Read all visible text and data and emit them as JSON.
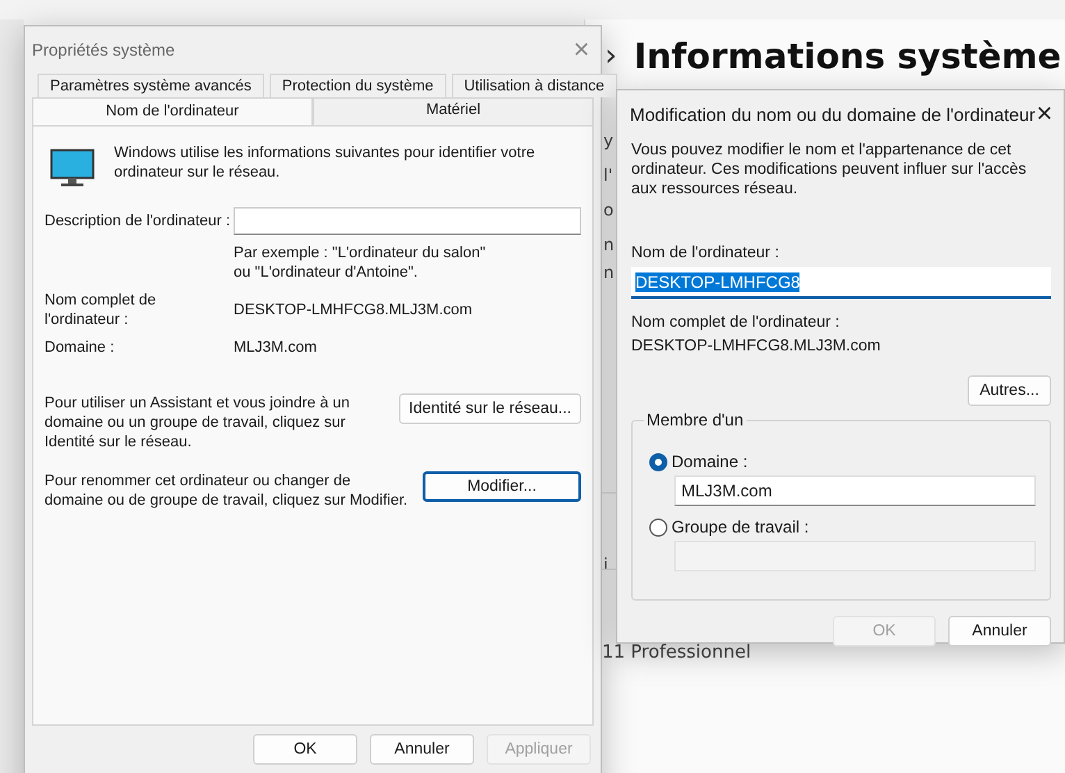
{
  "background_window": {
    "chevron": "›",
    "title": "Informations système",
    "fragments": [
      "y",
      "l'",
      "o",
      "n",
      "n",
      "i"
    ],
    "edition": "11 Professionnel"
  },
  "system_properties": {
    "title": "Propriétés système",
    "close": "×",
    "tab_rows": [
      [
        {
          "label": "Paramètres système avancés",
          "selected": false
        },
        {
          "label": "Protection du système",
          "selected": false
        },
        {
          "label": "Utilisation à distance",
          "selected": false
        }
      ],
      [
        {
          "label": "Nom de l'ordinateur",
          "selected": true
        },
        {
          "label": "Matériel",
          "selected": false
        }
      ]
    ],
    "intro": "Windows utilise les informations suivantes pour identifier votre ordinateur sur le réseau.",
    "description_label": "Description de l'ordinateur :",
    "example": "Par exemple : \"L'ordinateur du salon\" ou \"L'ordinateur d'Antoine\".",
    "full_name_label": "Nom complet de l'ordinateur :",
    "full_name_value": "DESKTOP-LMHFCG8.MLJ3M.com",
    "domain_label": "Domaine :",
    "domain_value": "MLJ3M.com",
    "actions": [
      {
        "text": "Pour utiliser un Assistant et vous joindre à un domaine ou un groupe de travail, cliquez sur Identité sur le réseau.",
        "button": "Identité sur le réseau...",
        "focused": false
      },
      {
        "text": "Pour renommer cet ordinateur ou changer de domaine ou de groupe de travail, cliquez sur Modifier.",
        "button": "Modifier...",
        "focused": true
      }
    ],
    "buttons": [
      {
        "label": "OK",
        "disabled": false
      },
      {
        "label": "Annuler",
        "disabled": false
      },
      {
        "label": "Appliquer",
        "disabled": true
      }
    ]
  },
  "rename_dialog": {
    "title": "Modification du nom ou du domaine de l'ordinateur",
    "close": "×",
    "intro": "Vous pouvez modifier le nom et l'appartenance de cet ordinateur. Ces modifications peuvent influer sur l'accès aux ressources réseau.",
    "name_label": "Nom de l'ordinateur :",
    "name_value": "DESKTOP-LMHFCG8",
    "name_selected": true,
    "full_name_label": "Nom complet de l'ordinateur :",
    "full_name_value": "DESKTOP-LMHFCG8.MLJ3M.com",
    "more_button": "Autres...",
    "member_of": {
      "legend": "Membre d'un",
      "options": [
        {
          "label": "Domaine :",
          "selected": true,
          "value": "MLJ3M.com"
        },
        {
          "label": "Groupe de travail :",
          "selected": false
        }
      ]
    },
    "buttons": [
      {
        "label": "OK",
        "disabled": true
      },
      {
        "label": "Annuler",
        "disabled": false
      }
    ]
  }
}
